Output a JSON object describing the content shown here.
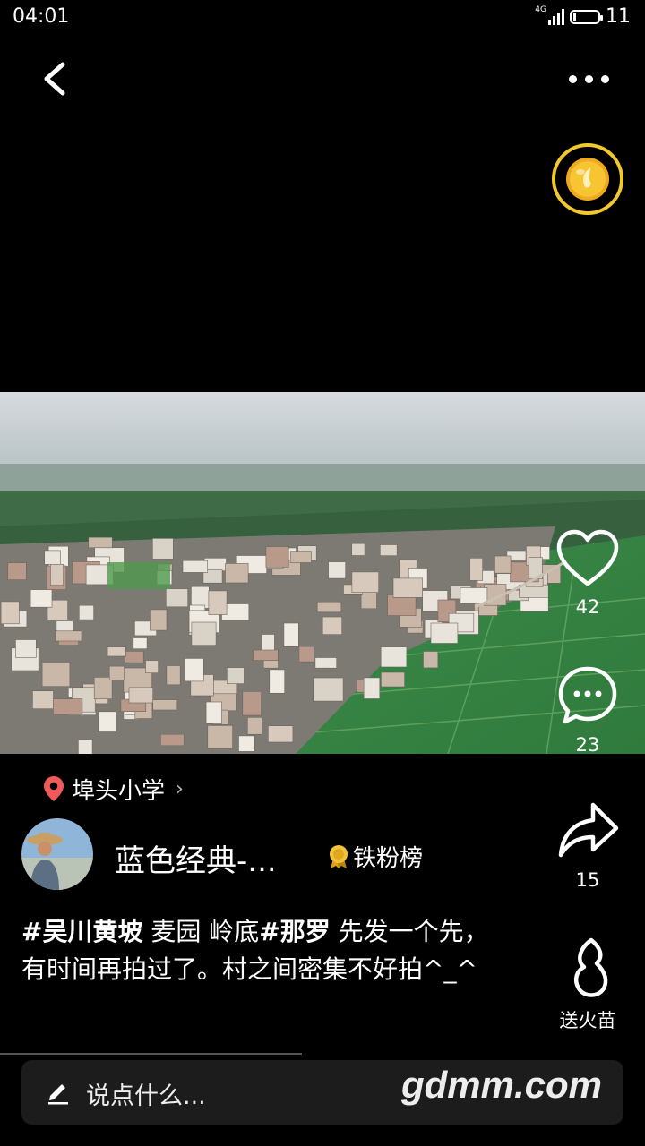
{
  "status_bar": {
    "time": "04:01",
    "network": "4G",
    "battery": "11",
    "battery_level": 0.11
  },
  "actions": {
    "like_count": "42",
    "comment_count": "23",
    "share_count": "15",
    "gift_label": "送火苗"
  },
  "location": {
    "name": "埠头小学"
  },
  "author": {
    "name": "蓝色经典-...",
    "fans_badge": "铁粉榜"
  },
  "caption": {
    "tag1": "#吴川黄坡",
    "text1": " 麦园 岭底",
    "tag2": "#那罗",
    "text2": " 先发一个先，有时间再拍过了。村之间密集不好拍^_^"
  },
  "comment_input": {
    "placeholder": "说点什么..."
  },
  "watermark": "gdmm.com",
  "icons": [
    "back-icon",
    "more-icon",
    "coin-icon",
    "heart-icon",
    "comment-icon",
    "share-icon",
    "flame-icon",
    "location-pin-icon",
    "medal-icon",
    "pencil-icon"
  ]
}
